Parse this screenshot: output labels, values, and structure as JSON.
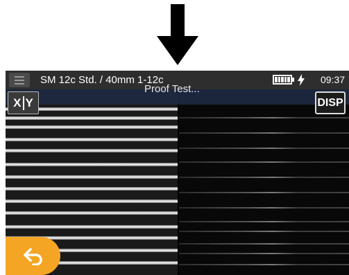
{
  "arrow": {
    "icon": "down-arrow-icon"
  },
  "status_bar": {
    "menu_icon": "hamburger-menu-icon",
    "title": "SM 12c Std. / 40mm 1-12c",
    "battery_icon": "battery-icon",
    "battery_level": 1.0,
    "charge_icon": "charging-plug-icon",
    "time": "09:37"
  },
  "viewport": {
    "status_message": "Proof Test...",
    "xy_button": {
      "x_label": "X",
      "y_label": "Y"
    },
    "disp_button": {
      "label": "DISP"
    },
    "back_button": {
      "icon": "back-arrow-icon"
    }
  },
  "colors": {
    "status_bar_bg": "#2e2e2e",
    "back_button_bg": "#f5a524",
    "screen_bg": "#000000"
  }
}
